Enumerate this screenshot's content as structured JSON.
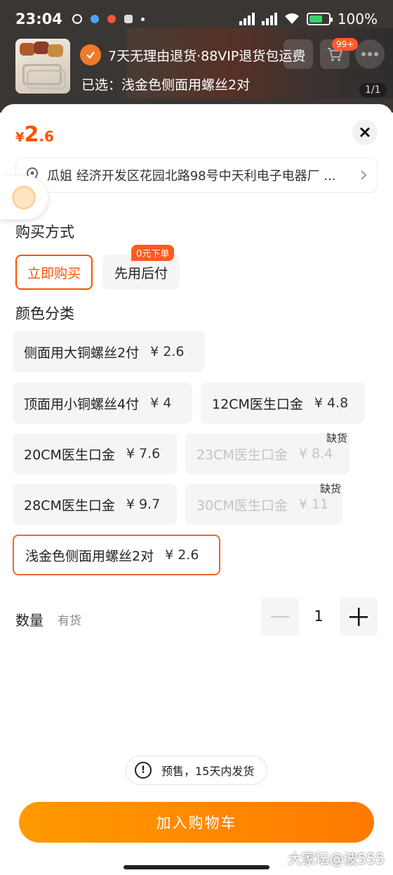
{
  "status_bar": {
    "time": "23:04",
    "battery": "100%"
  },
  "header": {
    "promo_text": "7天无理由退货·88VIP退货包运费",
    "selected_text": "已选：浅金色侧面用螺丝2对",
    "cart_badge": "99+",
    "pager": "1/1"
  },
  "sheet": {
    "price_symbol": "¥",
    "price_int": "2",
    "price_dec": ".6",
    "close_label": "×",
    "address": "瓜姐  经济开发区花园北路98号中天利电子电器厂 ..."
  },
  "purchase": {
    "title": "购买方式",
    "options": [
      {
        "label": "立即购买",
        "selected": true
      },
      {
        "label": "先用后付",
        "selected": false
      }
    ],
    "zero_tag": "0元下单"
  },
  "color": {
    "title": "颜色分类",
    "options": [
      {
        "label": "侧面用大铜螺丝2付",
        "price": "¥ 2.6",
        "available": true
      },
      {
        "label": "顶面用小铜螺丝4付",
        "price": "¥ 4",
        "available": true
      },
      {
        "label": "12CM医生口金",
        "price": "¥ 4.8",
        "available": true
      },
      {
        "label": "20CM医生口金",
        "price": "¥ 7.6",
        "available": true
      },
      {
        "label": "23CM医生口金",
        "price": "¥ 8.4",
        "available": false
      },
      {
        "label": "28CM医生口金",
        "price": "¥ 9.7",
        "available": true
      },
      {
        "label": "30CM医生口金",
        "price": "¥ 11",
        "available": false
      },
      {
        "label": "浅金色侧面用螺丝2对",
        "price": "¥ 2.6",
        "available": true,
        "selected": true
      }
    ],
    "out_of_stock": "缺货"
  },
  "quantity": {
    "label": "数量",
    "stock": "有货",
    "value": "1",
    "minus": "—",
    "plus": "+"
  },
  "notice": {
    "icon": "!",
    "text": "预售，15天内发货"
  },
  "cart_button": "加入购物车",
  "watermark": "大家坛@波555",
  "colors": {
    "accent": "#ff5000",
    "button": "#ff8a00"
  }
}
